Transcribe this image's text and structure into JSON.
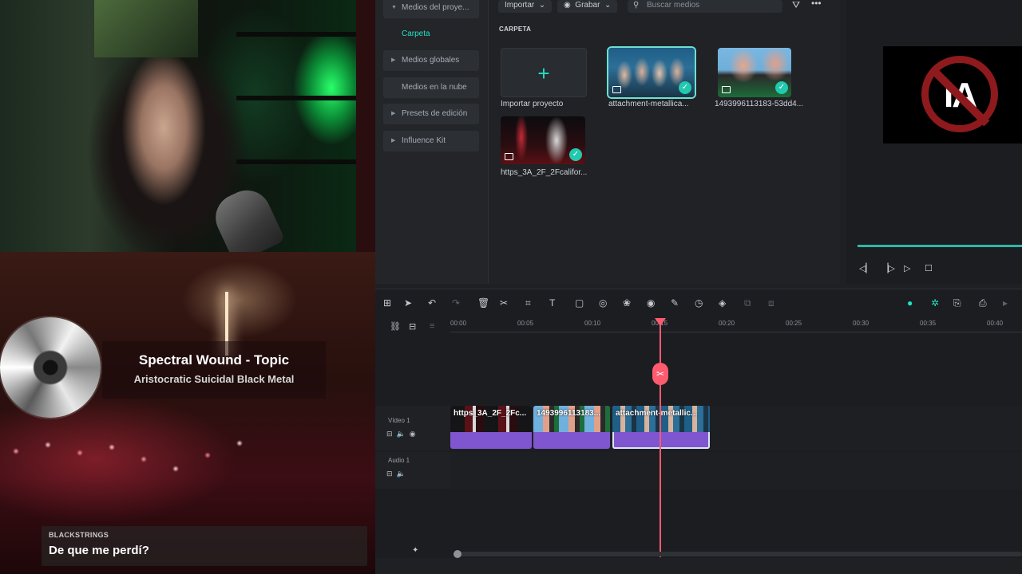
{
  "overlay": {
    "music": {
      "title": "Spectral Wound - Topic",
      "artist": "Aristocratic Suicidal Black Metal"
    },
    "chat": {
      "user": "BLACKSTRINGS",
      "message": "De que me perdí?"
    }
  },
  "editor": {
    "sidebar": {
      "items": [
        {
          "label": "Medios del proye...",
          "arrow": "▼"
        },
        {
          "label": "Carpeta",
          "arrow": ""
        },
        {
          "label": "Medios globales",
          "arrow": "▶"
        },
        {
          "label": "Medios en la nube",
          "arrow": ""
        },
        {
          "label": "Presets de edición",
          "arrow": "▶"
        },
        {
          "label": "Influence Kit",
          "arrow": "▶"
        }
      ]
    },
    "media_toolbar": {
      "import_label": "Importar",
      "record_label": "Grabar",
      "search_placeholder": "Buscar medios"
    },
    "folder_label": "CARPETA",
    "media_items": [
      {
        "label": "Importar proyecto"
      },
      {
        "label": "attachment-metallica..."
      },
      {
        "label": "1493996113183-53dd4..."
      },
      {
        "label": "https_3A_2F_2Fcalifor..."
      }
    ],
    "preview": {
      "logo_text": "IA"
    },
    "timeline": {
      "ruler_ticks": [
        "00:00",
        "00:05",
        "00:10",
        "00:15",
        "00:20",
        "00:25",
        "00:30",
        "00:35",
        "00:40"
      ],
      "tracks": [
        {
          "name": "Vídeo 1"
        },
        {
          "name": "Audio 1"
        }
      ],
      "clips": [
        {
          "label": "https_3A_2F_2Fc..."
        },
        {
          "label": "1493996113183..."
        },
        {
          "label": "attachment-metallic..."
        }
      ]
    }
  },
  "icons": {
    "search": "search-icon",
    "filter": "filter-icon",
    "more": "more-icon",
    "plus": "plus-icon",
    "check": "check-icon",
    "play": "play-icon",
    "stop": "stop-icon",
    "scissors": "scissors-icon"
  },
  "colors": {
    "accent": "#22e0c3",
    "clip": "#7f56d0",
    "playhead": "#ff5a6e"
  }
}
